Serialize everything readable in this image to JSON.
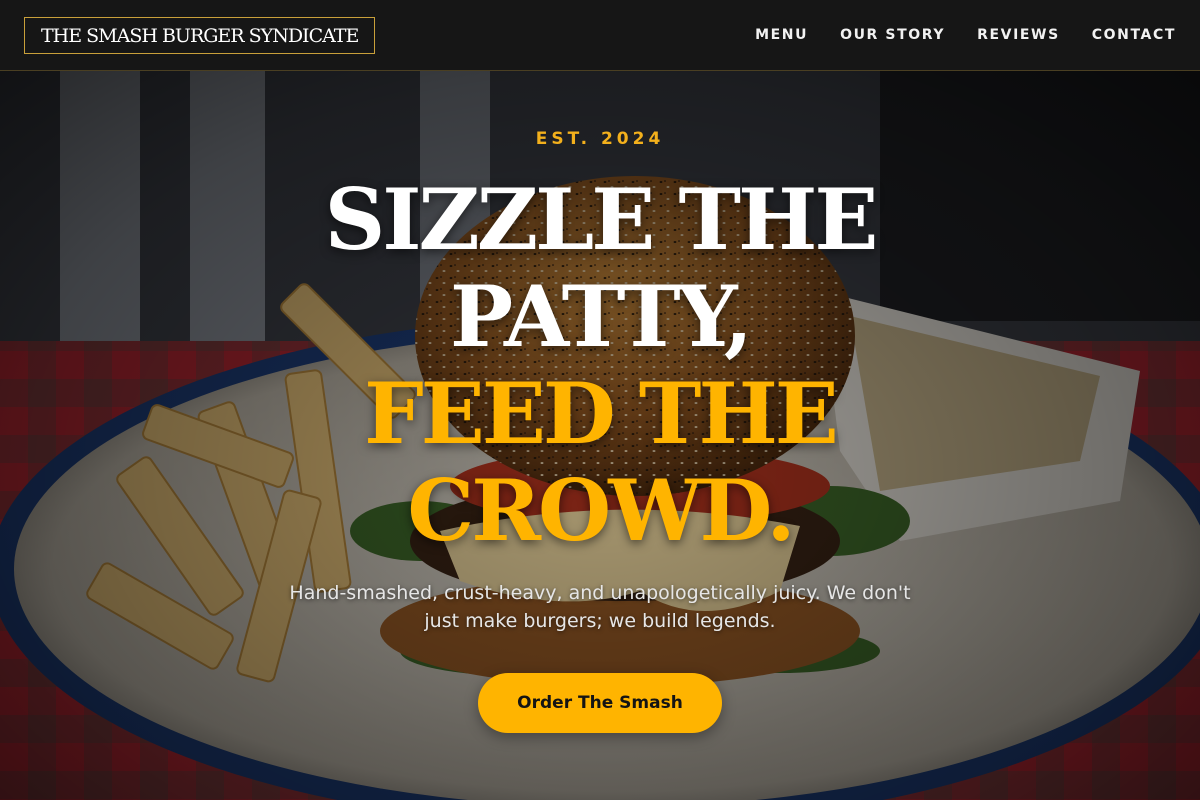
{
  "header": {
    "logo_text": "THE SMASH BURGER SYNDICATE",
    "nav": [
      {
        "label": "MENU"
      },
      {
        "label": "OUR STORY"
      },
      {
        "label": "REVIEWS"
      },
      {
        "label": "CONTACT"
      }
    ]
  },
  "hero": {
    "eyebrow": "EST. 2024",
    "headline_lines": [
      "SIZZLE THE",
      "PATTY,",
      "FEED THE",
      "CROWD."
    ],
    "tagline": "Hand-smashed, crust-heavy, and unapologetically juicy. We don't just make burgers; we build legends.",
    "cta_label": "Order The Smash",
    "background_image": "burger-on-plate-photo"
  },
  "colors": {
    "accent": "#ffb400",
    "header_bg": "#161616",
    "logo_border": "#c9a03a",
    "text_light": "#ffffff"
  }
}
